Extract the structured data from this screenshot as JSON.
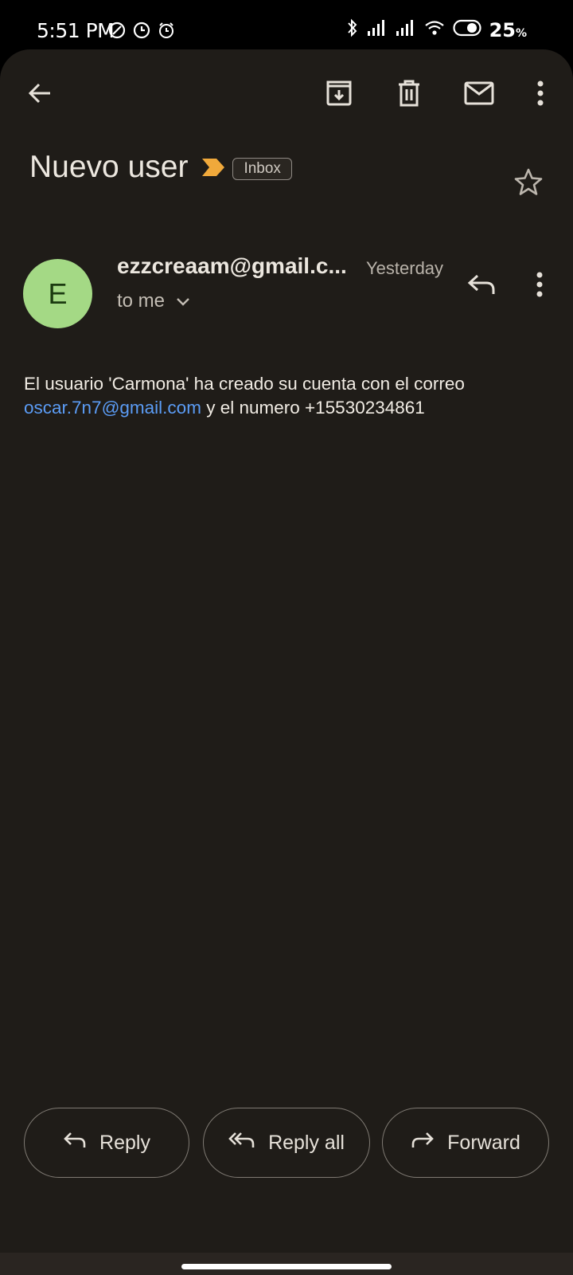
{
  "status_bar": {
    "time": "5:51 PM",
    "battery_percent": "25",
    "battery_unit": "%",
    "left_icons": [
      "no-disturb-icon",
      "clock-icon",
      "alarm-icon"
    ],
    "right_icons": [
      "bluetooth-icon",
      "signal-icon",
      "signal-icon",
      "wifi-icon",
      "battery-saver-toggle-icon"
    ]
  },
  "toolbar": {
    "icons": [
      "back-arrow-icon",
      "archive-icon",
      "delete-icon",
      "mark-unread-icon",
      "more-vert-icon"
    ]
  },
  "email": {
    "subject": "Nuevo user",
    "label": "Inbox",
    "importance_color": "#f0a93b",
    "sender_initial": "E",
    "sender": "ezzcreaam@gmail.c...",
    "date": "Yesterday",
    "recipient": "to me",
    "avatar_color": "#a4d985",
    "body_text": "El usuario 'Carmona' ha creado su cuenta con el correo",
    "body_link": "oscar.7n7@gmail.com",
    "body_suffix": "y el numero +15530234861"
  },
  "actions": {
    "reply": "Reply",
    "reply_all": "Reply all",
    "forward": "Forward"
  },
  "colors": {
    "background": "#1f1c18",
    "link": "#5b9cf5"
  }
}
